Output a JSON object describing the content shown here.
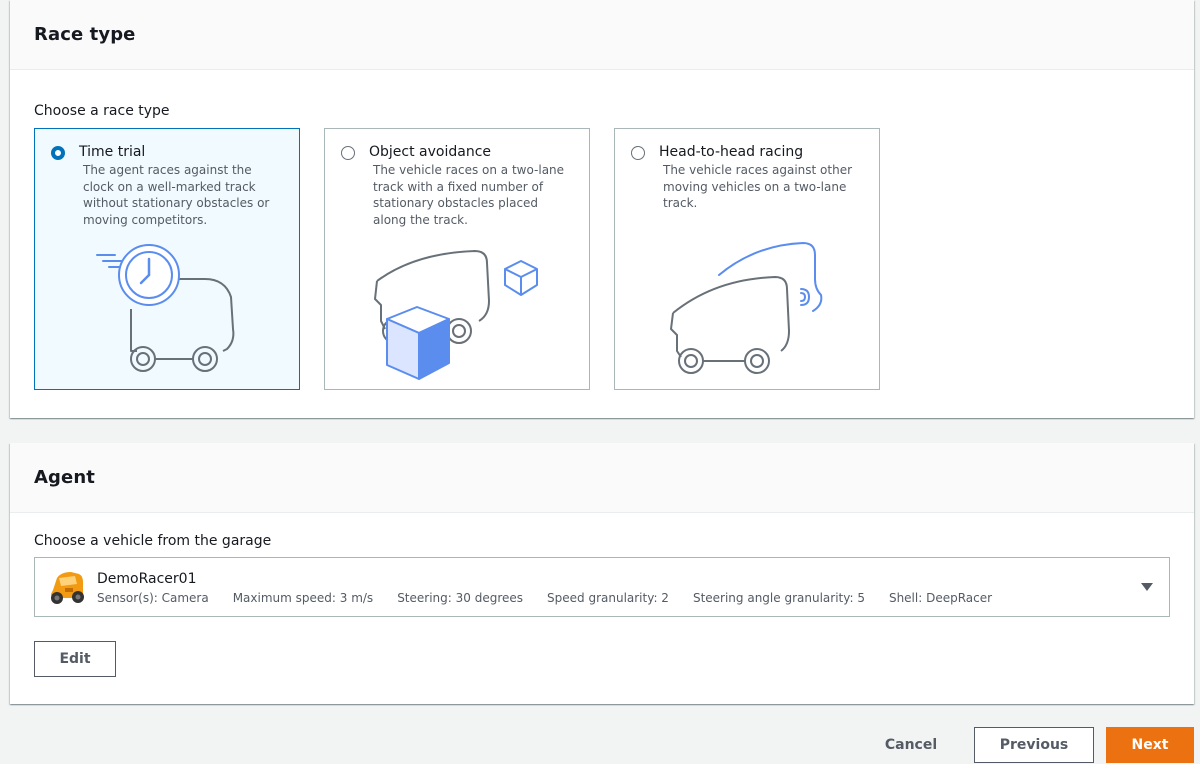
{
  "race_type": {
    "title": "Race type",
    "prompt": "Choose a race type",
    "options": [
      {
        "title": "Time trial",
        "description": "The agent races against the clock on a well-marked track without stationary obstacles or moving competitors.",
        "selected": true,
        "icon": "time-trial-illustration"
      },
      {
        "title": "Object avoidance",
        "description": "The vehicle races on a two-lane track with a fixed number of stationary obstacles placed along the track.",
        "selected": false,
        "icon": "object-avoidance-illustration"
      },
      {
        "title": "Head-to-head racing",
        "description": "The vehicle races against other moving vehicles on a two-lane track.",
        "selected": false,
        "icon": "head-to-head-illustration"
      }
    ]
  },
  "agent": {
    "title": "Agent",
    "prompt": "Choose a vehicle from the garage",
    "vehicle": {
      "name": "DemoRacer01",
      "specs": [
        "Sensor(s): Camera",
        "Maximum speed: 3 m/s",
        "Steering: 30 degrees",
        "Speed granularity: 2",
        "Steering angle granularity: 5",
        "Shell: DeepRacer"
      ]
    },
    "edit_label": "Edit"
  },
  "footer": {
    "cancel_label": "Cancel",
    "previous_label": "Previous",
    "next_label": "Next"
  },
  "colors": {
    "accent": "#0073bb",
    "primary_button": "#ec7211",
    "illustration_blue": "#5b8def",
    "illustration_gray": "#687078"
  }
}
